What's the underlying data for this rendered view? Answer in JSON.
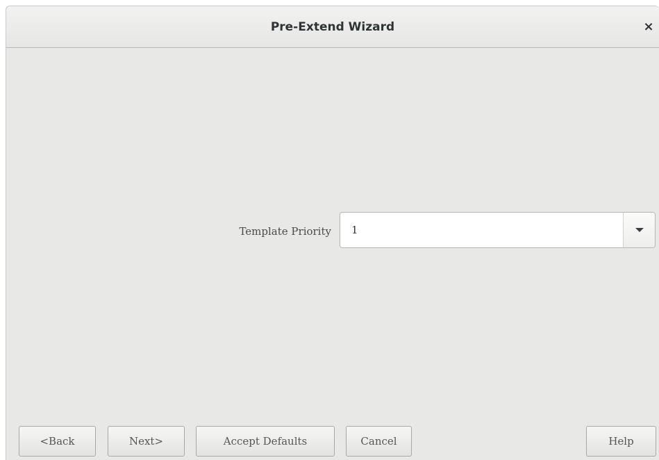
{
  "window": {
    "title": "Pre-Extend Wizard",
    "close_label": "×"
  },
  "form": {
    "template_priority": {
      "label": "Template Priority",
      "value": "1",
      "dropdown_icon": "caret-down-icon"
    }
  },
  "buttons": {
    "back": "<Back",
    "next": "Next>",
    "accept_defaults": "Accept Defaults",
    "cancel": "Cancel",
    "help": "Help"
  },
  "colors": {
    "window_bg": "#e8e8e7",
    "titlebar_bg": "#eeeeed",
    "text": "#2e3436"
  }
}
